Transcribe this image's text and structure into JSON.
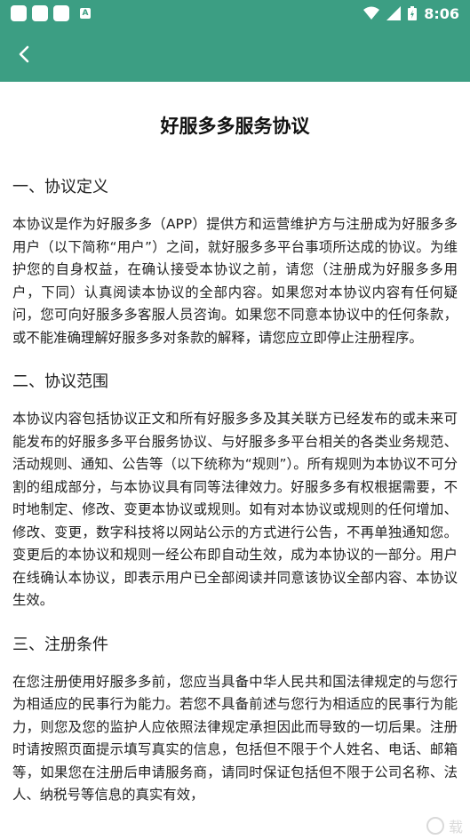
{
  "status_bar": {
    "time": "8:06",
    "notification_letter": "A"
  },
  "header": {
    "back_icon": "chevron-left-icon"
  },
  "document": {
    "title": "好服多多服务协议",
    "sections": [
      {
        "heading": "一、协议定义",
        "body": "本协议是作为好服多多（APP）提供方和运营维护方与注册成为好服多多用户（以下简称“用户”）之间，就好服多多平台事项所达成的协议。为维护您的自身权益，在确认接受本协议之前，请您（注册成为好服多多用户，下同）认真阅读本协议的全部内容。如果您对本协议内容有任何疑问，您可向好服多多客服人员咨询。如果您不同意本协议中的任何条款，或不能准确理解好服多多对条款的解释，请您应立即停止注册程序。"
      },
      {
        "heading": "二、协议范围",
        "body": "本协议内容包括协议正文和所有好服多多及其关联方已经发布的或未来可能发布的好服多多平台服务协议、与好服多多平台相关的各类业务规范、活动规则、通知、公告等（以下统称为“规则”）。所有规则为本协议不可分割的组成部分，与本协议具有同等法律效力。好服多多有权根据需要，不时地制定、修改、变更本协议或规则。如有对本协议或规则的任何增加、修改、变更，数字科技将以网站公示的方式进行公告，不再单独通知您。变更后的本协议和规则一经公布即自动生效，成为本协议的一部分。用户在线确认本协议，即表示用户已全部阅读并同意该协议全部内容、本协议生效。"
      },
      {
        "heading": "三、注册条件",
        "body": "在您注册使用好服多多前，您应当具备中华人民共和国法律规定的与您行为相适应的民事行为能力。若您不具备前述与您行为相适应的民事行为能力，则您及您的监护人应依照法律规定承担因此而导致的一切后果。注册时请按照页面提示填写真实的信息，包括但不限于个人姓名、电话、邮箱等，如果您在注册后申请服务商，请同时保证包括但不限于公司名称、法人、纳税号等信息的真实有效，"
      }
    ]
  },
  "watermark": {
    "text": "载"
  }
}
